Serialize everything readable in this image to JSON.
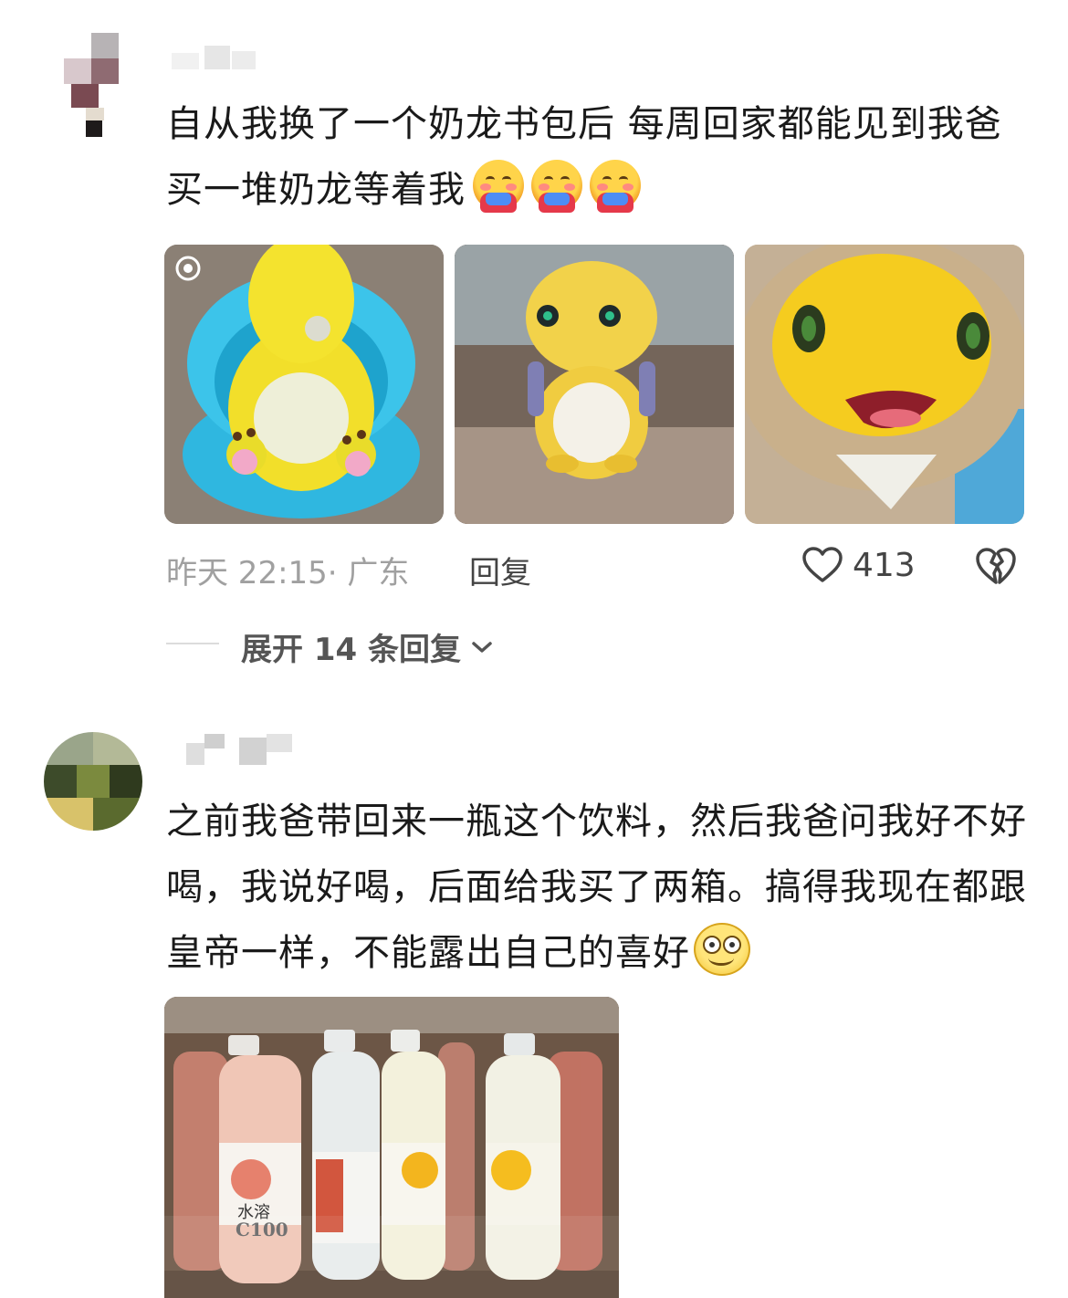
{
  "comments": [
    {
      "text": "自从我换了一个奶龙书包后 每周回家都能见到我爸买一堆奶龙等着我",
      "emoji_count": 3,
      "emoji_name": "hugging-face-emoji",
      "images": [
        "nailong-toy-in-blue-seat",
        "nailong-toy-with-backpack",
        "nailong-plush-head"
      ],
      "time": "昨天 22:15",
      "location": "· 广东",
      "reply_label": "回复",
      "likes": "413",
      "expand_label": "展开 14 条回复"
    },
    {
      "text": "之前我爸带回来一瓶这个饮料，然后我爸问我好不好喝，我说好喝，后面给我买了两箱。搞得我现在都跟皇帝一样，不能露出自己的喜好",
      "emoji_name": "smiling-face-emoji",
      "images": [
        "drink-bottles-on-shelf"
      ]
    }
  ],
  "bottle_labels": [
    "水溶",
    "C100"
  ],
  "colors": {
    "text": "#1a1a1a",
    "meta": "#a0a0a0",
    "action": "#444444"
  }
}
